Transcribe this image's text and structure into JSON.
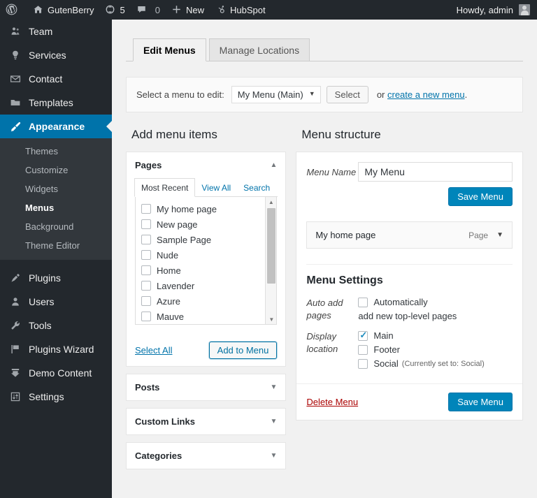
{
  "adminbar": {
    "wp_logo": "wordpress-logo",
    "site_name": "GutenBerry",
    "updates_count": "5",
    "comments_count": "0",
    "new_label": "New",
    "hubspot_label": "HubSpot",
    "howdy": "Howdy, admin"
  },
  "sidebar": {
    "items": [
      {
        "label": "Team",
        "icon": "users-icon",
        "current": false
      },
      {
        "label": "Services",
        "icon": "lightbulb-icon",
        "current": false
      },
      {
        "label": "Contact",
        "icon": "email-icon",
        "current": false
      },
      {
        "label": "Templates",
        "icon": "folder-icon",
        "current": false
      },
      {
        "label": "Appearance",
        "icon": "paintbrush-icon",
        "current": true
      }
    ],
    "submenu": [
      {
        "label": "Themes",
        "current": false
      },
      {
        "label": "Customize",
        "current": false
      },
      {
        "label": "Widgets",
        "current": false
      },
      {
        "label": "Menus",
        "current": true
      },
      {
        "label": "Background",
        "current": false
      },
      {
        "label": "Theme Editor",
        "current": false
      }
    ],
    "items_after": [
      {
        "label": "Plugins",
        "icon": "plug-icon",
        "current": false
      },
      {
        "label": "Users",
        "icon": "user-icon",
        "current": false
      },
      {
        "label": "Tools",
        "icon": "wrench-icon",
        "current": false
      },
      {
        "label": "Plugins Wizard",
        "icon": "flag-icon",
        "current": false
      },
      {
        "label": "Demo Content",
        "icon": "download-icon",
        "current": false
      },
      {
        "label": "Settings",
        "icon": "sliders-icon",
        "current": false
      }
    ]
  },
  "tabs": [
    {
      "label": "Edit Menus",
      "active": true
    },
    {
      "label": "Manage Locations",
      "active": false
    }
  ],
  "selectbar": {
    "lead": "Select a menu to edit:",
    "selected_menu": "My Menu (Main)",
    "select_button": "Select",
    "or": "or",
    "create_link": "create a new menu",
    "period": "."
  },
  "left": {
    "heading": "Add menu items",
    "pages_panel": {
      "title": "Pages",
      "collapse_icon": "chevron-up-icon",
      "tabs": [
        {
          "label": "Most Recent",
          "active": true
        },
        {
          "label": "View All",
          "active": false
        },
        {
          "label": "Search",
          "active": false
        }
      ],
      "items": [
        {
          "label": "My home page",
          "checked": false
        },
        {
          "label": "New page",
          "checked": false
        },
        {
          "label": "Sample Page",
          "checked": false
        },
        {
          "label": "Nude",
          "checked": false
        },
        {
          "label": "Home",
          "checked": false
        },
        {
          "label": "Lavender",
          "checked": false
        },
        {
          "label": "Azure",
          "checked": false
        },
        {
          "label": "Mauve",
          "checked": false
        }
      ],
      "select_all": "Select All",
      "add_to_menu": "Add to Menu"
    },
    "panels": [
      {
        "title": "Posts",
        "expand_icon": "chevron-down-icon"
      },
      {
        "title": "Custom Links",
        "expand_icon": "chevron-down-icon"
      },
      {
        "title": "Categories",
        "expand_icon": "chevron-down-icon"
      }
    ]
  },
  "right": {
    "heading": "Menu structure",
    "menu_name_label": "Menu Name",
    "menu_name_value": "My Menu",
    "save_menu_top": "Save Menu",
    "menu_items": [
      {
        "label": "My home page",
        "type": "Page",
        "toggle_icon": "chevron-down-icon"
      }
    ],
    "settings": {
      "title": "Menu Settings",
      "auto_add_label": "Auto add pages",
      "auto_add_option": "Automatically",
      "auto_add_note": "add new top-level pages",
      "auto_add_checked": false,
      "display_label": "Display location",
      "locations": [
        {
          "label": "Main",
          "checked": true,
          "note": ""
        },
        {
          "label": "Footer",
          "checked": false,
          "note": ""
        },
        {
          "label": "Social",
          "checked": false,
          "note": "(Currently set to: Social)"
        }
      ]
    },
    "delete_menu": "Delete Menu",
    "save_menu_bottom": "Save Menu"
  },
  "colors": {
    "wp_blue": "#0073aa",
    "primary_button": "#0085ba",
    "admin_dark": "#23282d",
    "submenu_dark": "#32373c",
    "link": "#0073aa",
    "danger": "#a00"
  }
}
